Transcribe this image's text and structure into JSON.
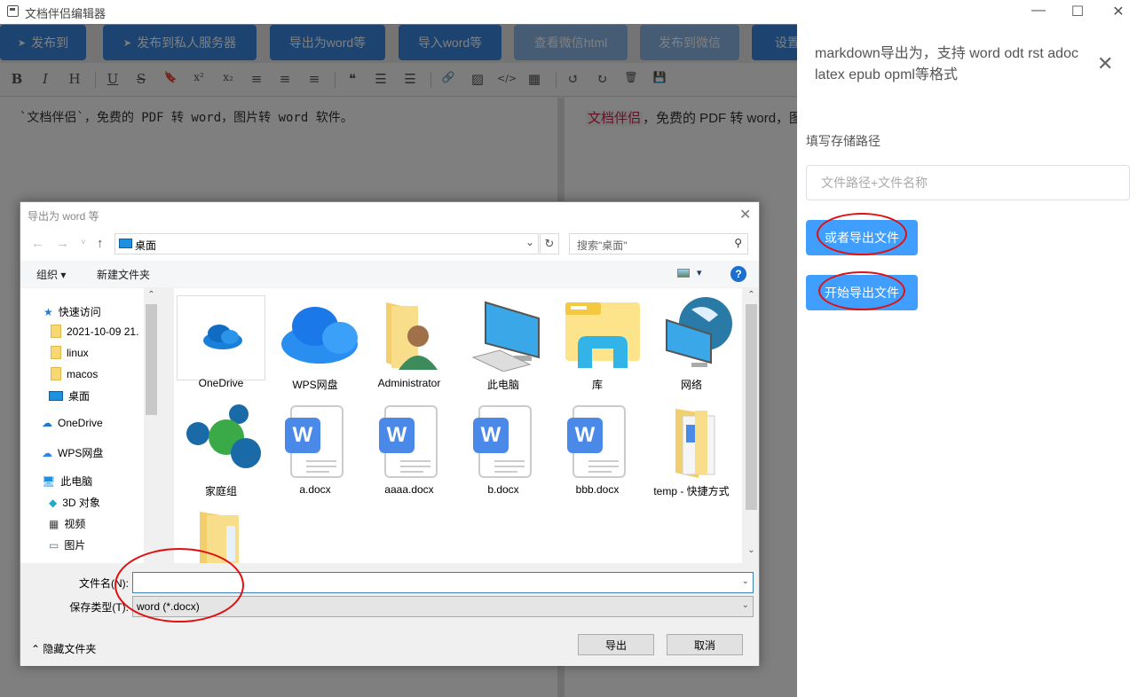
{
  "window": {
    "title": "文档伴侣编辑器",
    "minimize": "—",
    "maximize": "☐",
    "close": "✕"
  },
  "toolbar": {
    "buttons": [
      {
        "label": "发布到",
        "icon": "paper-plane-icon"
      },
      {
        "label": "发布到私人服务器",
        "icon": "paper-plane-icon"
      },
      {
        "label": "导出为word等"
      },
      {
        "label": "导入word等"
      },
      {
        "label": "查看微信html"
      },
      {
        "label": "发布到微信"
      },
      {
        "label": "设置"
      }
    ],
    "plane_glyph": "➤"
  },
  "format": {
    "bold": "B",
    "italic": "I",
    "heading": "H",
    "underline": "U",
    "strike": "S",
    "bookmark": "🔖",
    "sup": "x²",
    "sub": "x₂",
    "align_left": "≡",
    "align_center": "≡",
    "align_right": "≡",
    "quote": "❝",
    "ol": "☰",
    "ul": "☰",
    "link": "🔗",
    "image": "▨",
    "code": "</>",
    "table": "▦",
    "undo": "↺",
    "redo": "↻",
    "trash": "🗑",
    "save": "💾"
  },
  "editor": {
    "text": "`文档伴侣`，免费的 PDF 转 word，图片转 word 软件。"
  },
  "preview": {
    "code": "文档伴侣",
    "rest": "，免费的 PDF 转 word，图片转 word 软件。"
  },
  "drawer": {
    "title": "markdown导出为，支持 word odt rst adoc latex epub opml等格式",
    "close": "✕",
    "path_label": "填写存储路径",
    "path_placeholder": "文件路径+文件名称",
    "path_value": "",
    "export_alt": "或者导出文件",
    "export_start": "开始导出文件"
  },
  "dialog": {
    "title": "导出为 word 等",
    "close": "✕",
    "nav": {
      "back": "←",
      "forward": "→",
      "recent": "˅",
      "up": "↑"
    },
    "address": "桌面",
    "address_chevron": "⌄",
    "refresh": "↻",
    "search_placeholder": "搜索\"桌面\"",
    "search_icon": "⚲",
    "organize": "组织 ▾",
    "new_folder": "新建文件夹",
    "view": "▾",
    "help": "?",
    "nav_pane": [
      {
        "label": "快速访问",
        "icon": "star-icon",
        "glyph": "★"
      },
      {
        "label": "2021-10-09 21.",
        "icon": "folder-icon"
      },
      {
        "label": "linux",
        "icon": "folder-icon"
      },
      {
        "label": "macos",
        "icon": "folder-icon"
      },
      {
        "label": "桌面",
        "icon": "desktop-icon"
      },
      {
        "label": "OneDrive",
        "icon": "cloud-icon",
        "glyph": "☁"
      },
      {
        "label": "WPS网盘",
        "icon": "cloud-icon",
        "glyph": "☁"
      },
      {
        "label": "此电脑",
        "icon": "computer-icon",
        "glyph": "🖥"
      },
      {
        "label": "3D 对象",
        "icon": "cube-icon",
        "glyph": "◆"
      },
      {
        "label": "视频",
        "icon": "film-icon",
        "glyph": "▦"
      },
      {
        "label": "图片",
        "icon": "picture-icon",
        "glyph": "▭"
      }
    ],
    "files": [
      {
        "label": "OneDrive",
        "icon": "onedrive-icon"
      },
      {
        "label": "WPS网盘",
        "icon": "wps-cloud-icon"
      },
      {
        "label": "Administrator",
        "icon": "user-folder-icon"
      },
      {
        "label": "此电脑",
        "icon": "computer-icon"
      },
      {
        "label": "库",
        "icon": "library-icon"
      },
      {
        "label": "网络",
        "icon": "network-icon"
      },
      {
        "label": "家庭组",
        "icon": "homegroup-icon"
      },
      {
        "label": "a.docx",
        "icon": "docx-icon"
      },
      {
        "label": "aaaa.docx",
        "icon": "docx-icon"
      },
      {
        "label": "b.docx",
        "icon": "docx-icon"
      },
      {
        "label": "bbb.docx",
        "icon": "docx-icon"
      },
      {
        "label": "temp - 快捷方式",
        "icon": "folder-shortcut-icon"
      },
      {
        "label": "",
        "icon": "folder-icon"
      }
    ],
    "filename_label": "文件名(N):",
    "filename_value": "",
    "filetype_label": "保存类型(T):",
    "filetype_value": "word (*.docx)",
    "chevron": "⌄",
    "hide_folders": "⌃ 隐藏文件夹",
    "save": "导出",
    "cancel": "取消",
    "scroll_up": "⌃",
    "scroll_down": "⌄",
    "docx_letter": "W"
  },
  "annotation_color": "#e01010"
}
